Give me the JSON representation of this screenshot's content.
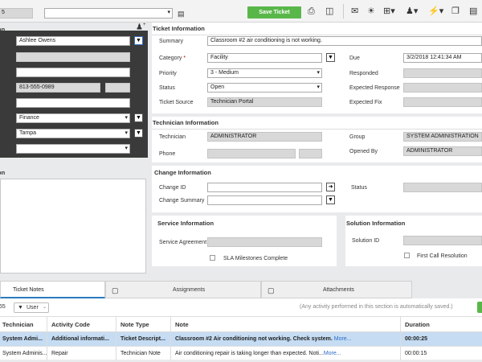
{
  "toolbar": {
    "ticket_id_fragment": "5",
    "save_label": "Save Ticket"
  },
  "requester": {
    "section_fragment": "on",
    "name": "Ashlee Owens",
    "phone": "813-555-0989",
    "department": "Finance",
    "location": "Tampa"
  },
  "description_section_fragment": "on",
  "ticket_info": {
    "header": "Ticket Information",
    "summary_label": "Summary",
    "summary_value": "Classroom #2 air conditioning is not working.",
    "category_label": "Category",
    "category_required": "*",
    "category_value": "Facility",
    "priority_label": "Priority",
    "priority_value": "3 - Medium",
    "status_label": "Status",
    "status_value": "Open",
    "source_label": "Ticket Source",
    "source_value": "Technician Portal",
    "due_label": "Due",
    "due_value": "3/2/2018 12:41:34 AM",
    "responded_label": "Responded",
    "expected_response_label": "Expected Response",
    "expected_fix_label": "Expected Fix"
  },
  "tech_info": {
    "header": "Technician Information",
    "technician_label": "Technician",
    "technician_value": "ADMINISTRATOR",
    "phone_label": "Phone",
    "group_label": "Group",
    "group_value": "SYSTEM ADMINISTRATION",
    "opened_by_label": "Opened By",
    "opened_by_value": "ADMINISTRATOR"
  },
  "change_info": {
    "header": "Change Information",
    "change_id_label": "Change ID",
    "change_summary_label": "Change Summary",
    "status_label": "Status"
  },
  "service_info": {
    "header": "Service Information",
    "agreement_label": "Service Agreement",
    "sla_label": "SLA Milestones Complete"
  },
  "solution_info": {
    "header": "Solution Information",
    "solution_id_label": "Solution ID",
    "first_call_label": "First Call Resolution"
  },
  "tabs": [
    {
      "label": "Ticket Notes"
    },
    {
      "label": "Assignments"
    },
    {
      "label": "Attachments"
    }
  ],
  "notes_toolbar": {
    "count_fragment": "55",
    "filter_label": "User",
    "note": "(Any activity performed in this section is automatically saved.)"
  },
  "table": {
    "columns": [
      "Technician",
      "Activity Code",
      "Note Type",
      "Note",
      "Duration"
    ],
    "rows": [
      {
        "technician": "System Admi...",
        "activity": "Additional informati...",
        "type": "Ticket Descript...",
        "note": "Classroom #2 Air conditioning not working. Check system.",
        "more": "More...",
        "duration": "00:00:25"
      },
      {
        "technician": "System Adminis...",
        "activity": "Repair",
        "type": "Technician Note",
        "note": "Air conditioning repair is taking longer than expected. Noti...",
        "more": "More...",
        "duration": "00:00:15"
      }
    ]
  },
  "colors": {
    "save_green": "#59b74a",
    "selected_row": "#c5dcf3",
    "dark_panel": "#3a3a3a"
  }
}
